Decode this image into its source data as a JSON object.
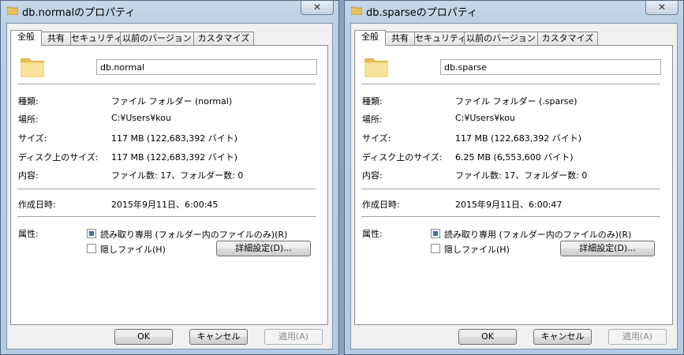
{
  "windows": [
    {
      "title": "db.normalのプロパティ",
      "close_label": "✕",
      "tabs": [
        "全般",
        "共有",
        "セキュリティ",
        "以前のバージョン",
        "カスタマイズ"
      ],
      "name_value": "db.normal",
      "rows1": [
        {
          "label": "種類:",
          "value": "ファイル フォルダー (normal)"
        },
        {
          "label": "場所:",
          "value": "C:¥Users¥kou"
        },
        {
          "label": "サイズ:",
          "value": "117 MB (122,683,392 バイト)"
        },
        {
          "label": "ディスク上のサイズ:",
          "value": "117 MB (122,683,392 バイト)"
        },
        {
          "label": "内容:",
          "value": "ファイル数: 17、フォルダー数: 0"
        }
      ],
      "created": {
        "label": "作成日時:",
        "value": "2015年9月11日、6:00:45"
      },
      "attributes": {
        "label": "属性:",
        "readonly_label": "読み取り専用 (フォルダー内のファイルのみ)(R)",
        "readonly_checked": true,
        "hidden_label": "隠しファイル(H)",
        "hidden_checked": false,
        "advanced_label": "詳細設定(D)..."
      },
      "buttons": {
        "ok": "OK",
        "cancel": "キャンセル",
        "apply": "適用(A)"
      }
    },
    {
      "title": "db.sparseのプロパティ",
      "close_label": "✕",
      "tabs": [
        "全般",
        "共有",
        "セキュリティ",
        "以前のバージョン",
        "カスタマイズ"
      ],
      "name_value": "db.sparse",
      "rows1": [
        {
          "label": "種類:",
          "value": "ファイル フォルダー (.sparse)"
        },
        {
          "label": "場所:",
          "value": "C:¥Users¥kou"
        },
        {
          "label": "サイズ:",
          "value": "117 MB (122,683,392 バイト)"
        },
        {
          "label": "ディスク上のサイズ:",
          "value": "6.25 MB (6,553,600 バイト)"
        },
        {
          "label": "内容:",
          "value": "ファイル数: 17、フォルダー数: 0"
        }
      ],
      "created": {
        "label": "作成日時:",
        "value": "2015年9月11日、6:00:47"
      },
      "attributes": {
        "label": "属性:",
        "readonly_label": "読み取り専用 (フォルダー内のファイルのみ)(R)",
        "readonly_checked": true,
        "hidden_label": "隠しファイル(H)",
        "hidden_checked": false,
        "advanced_label": "詳細設定(D)..."
      },
      "buttons": {
        "ok": "OK",
        "cancel": "キャンセル",
        "apply": "適用(A)"
      }
    }
  ],
  "colors": {
    "accent": "#3b6fb6",
    "folder": "#f2d37a"
  }
}
